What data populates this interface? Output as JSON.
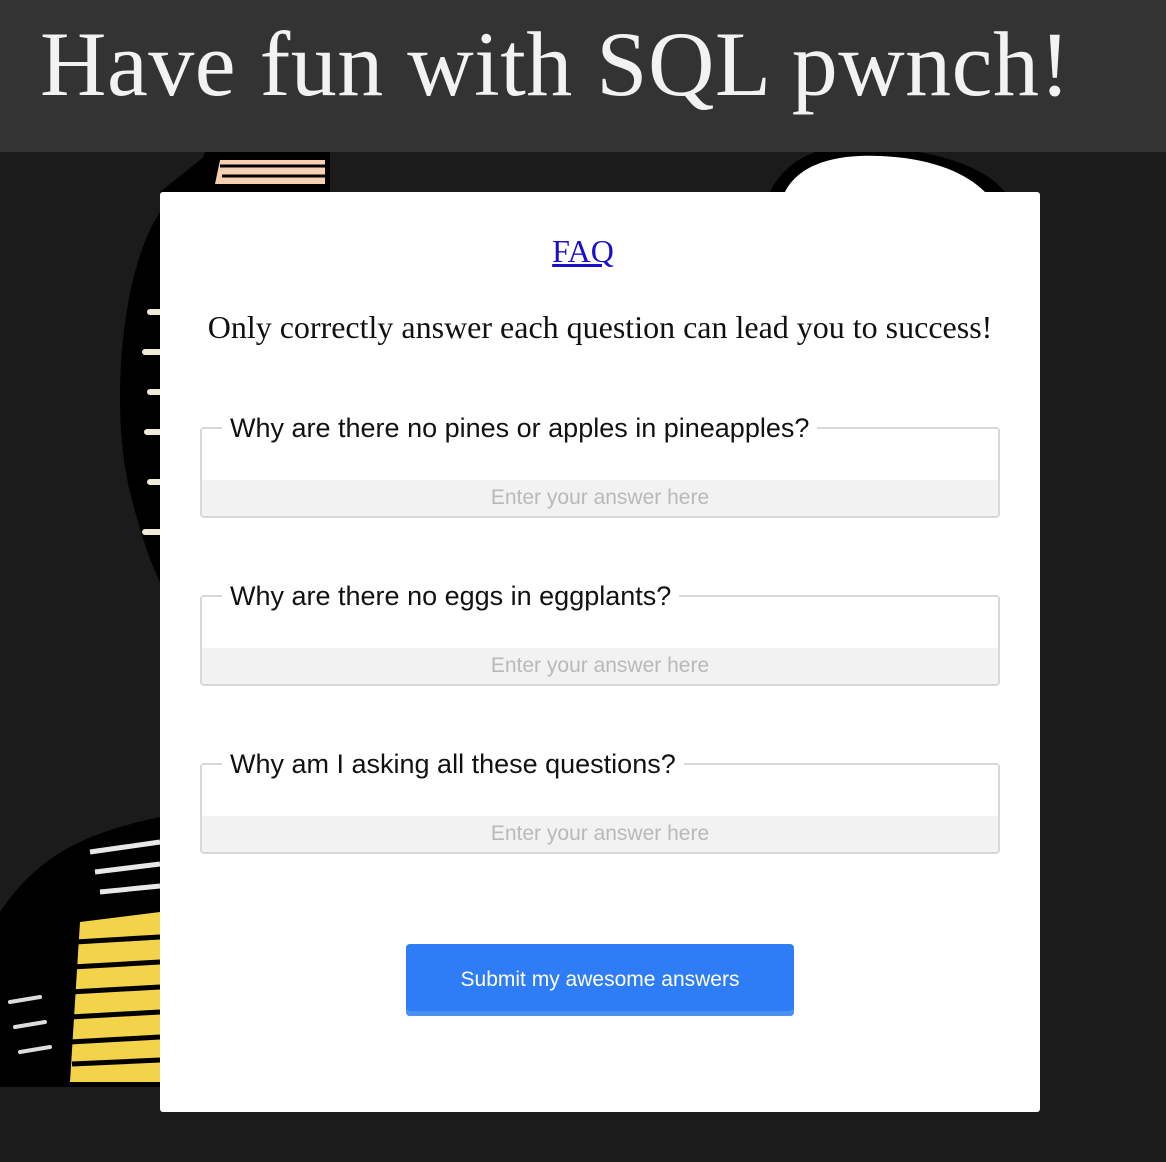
{
  "header": {
    "title": "Have fun with SQL pwnch!"
  },
  "form": {
    "faq_link": "FAQ",
    "intro": "Only correctly answer each question can lead you to success!",
    "questions": [
      {
        "label": "Why are there no pines or apples in pineapples?",
        "placeholder": "Enter your answer here",
        "value": ""
      },
      {
        "label": "Why are there no eggs in eggplants?",
        "placeholder": "Enter your answer here",
        "value": ""
      },
      {
        "label": "Why am I asking all these questions?",
        "placeholder": "Enter your answer here",
        "value": ""
      }
    ],
    "submit_label": "Submit my awesome answers"
  },
  "colors": {
    "header_bg": "#333333",
    "page_bg": "#1b1b1b",
    "card_bg": "#ffffff",
    "accent": "#2f7df6",
    "link": "#1a0dcc"
  }
}
